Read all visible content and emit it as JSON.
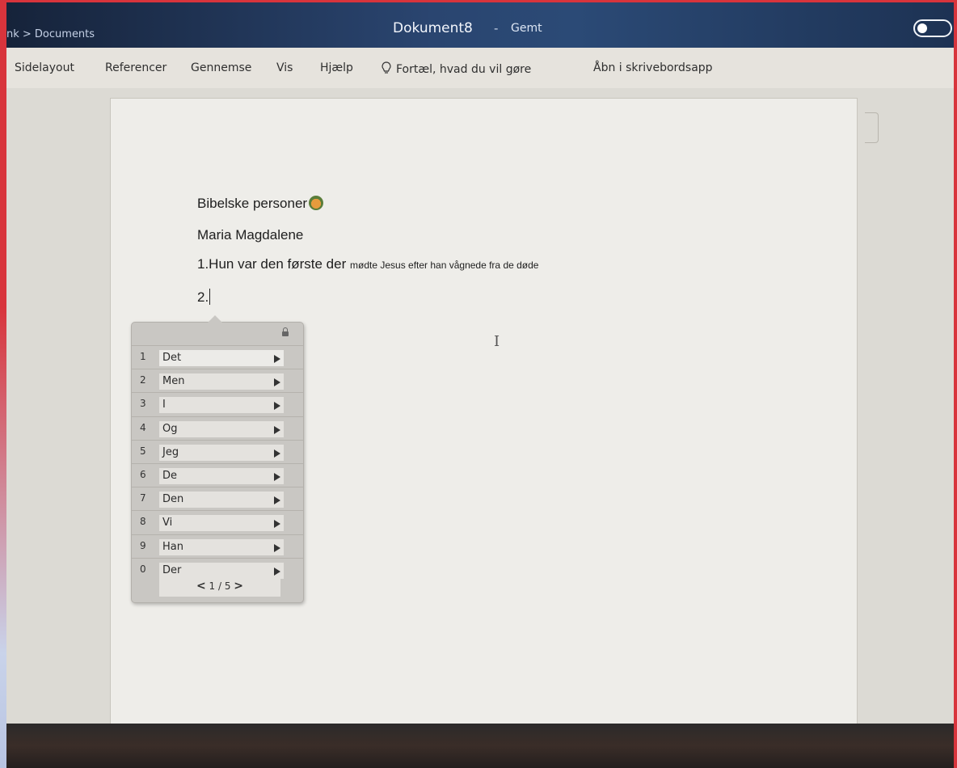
{
  "title_bar": {
    "breadcrumb": "nk > Documents",
    "doc_title": "Dokument8",
    "separator": "-",
    "status": "Gemt"
  },
  "ribbon": {
    "tabs": [
      "Sidelayout",
      "Referencer",
      "Gennemse",
      "Vis",
      "Hjælp"
    ],
    "tell_me": "Fortæl, hvad du vil gøre",
    "open_desktop": "Åbn i skrivebordsapp"
  },
  "document": {
    "line1": "Bibelske personer",
    "line1_emoji": "person-emoji-icon",
    "line2": "Maria Magdalene",
    "line3_large": "1.Hun var den første der",
    "line3_small": "mødte Jesus efter han vågnede fra de døde",
    "line4": "2."
  },
  "ime_popup": {
    "candidates": [
      {
        "num": "1",
        "word": "Det"
      },
      {
        "num": "2",
        "word": "Men"
      },
      {
        "num": "3",
        "word": "I"
      },
      {
        "num": "4",
        "word": "Og"
      },
      {
        "num": "5",
        "word": "Jeg"
      },
      {
        "num": "6",
        "word": "De"
      },
      {
        "num": "7",
        "word": "Den"
      },
      {
        "num": "8",
        "word": "Vi"
      },
      {
        "num": "9",
        "word": "Han"
      },
      {
        "num": "0",
        "word": "Der"
      }
    ],
    "pager": "1 / 5",
    "pager_prev": "<",
    "pager_next": ">"
  },
  "colors": {
    "title_bar": "#2a4570",
    "ribbon": "#e6e3dd",
    "page": "#eeede9",
    "frame_accent": "#d8343c"
  }
}
